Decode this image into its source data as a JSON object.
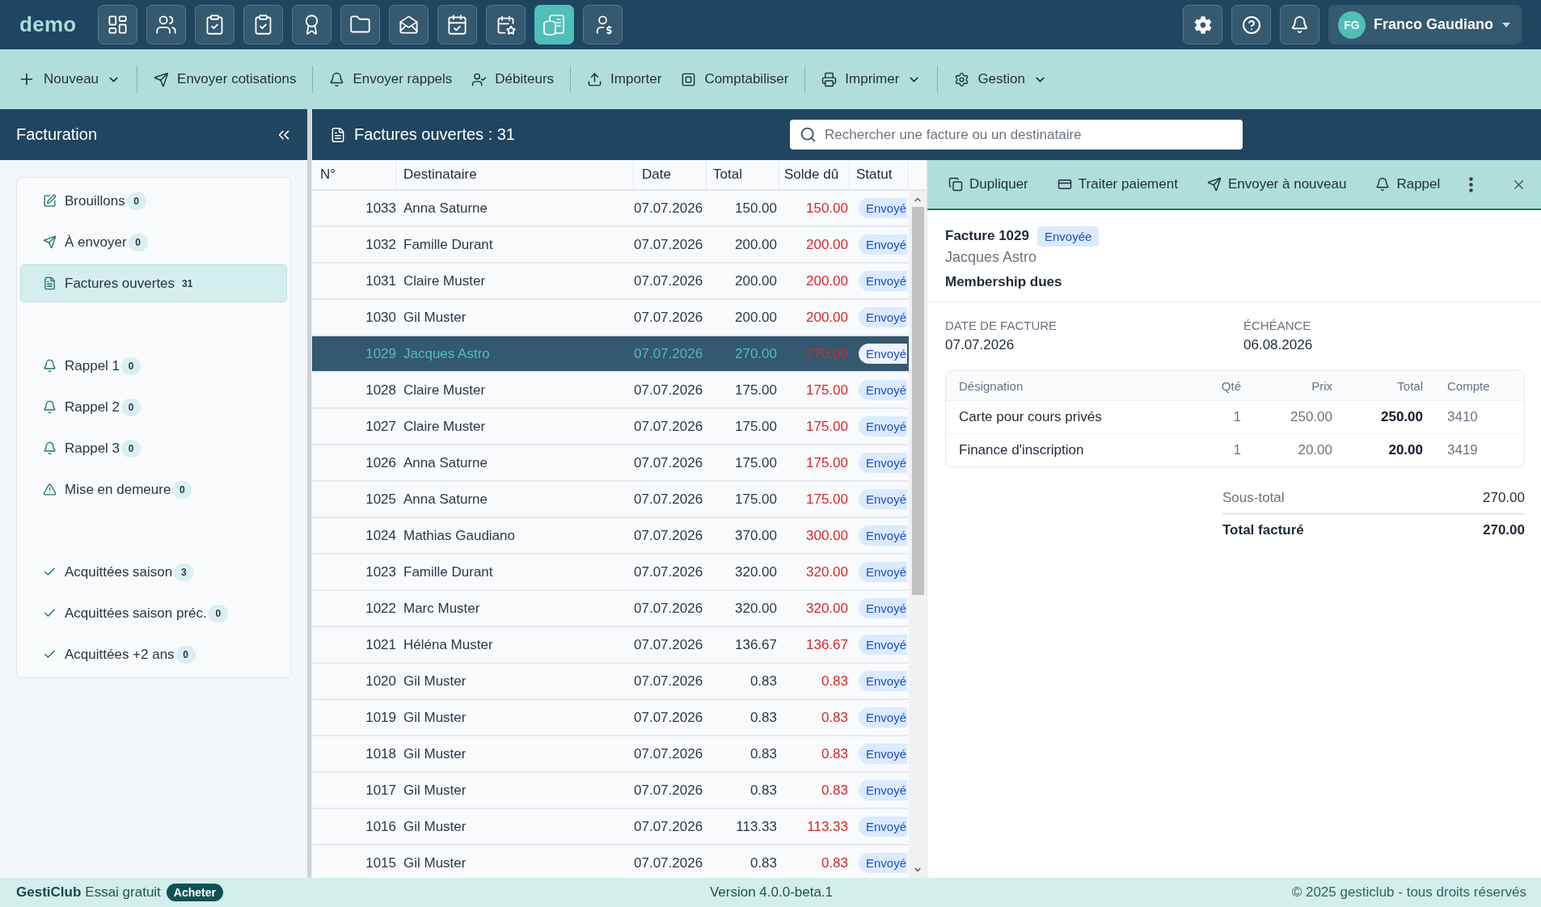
{
  "top_bar": {
    "logo": "demo",
    "apps": [
      {
        "selected": false
      },
      {
        "selected": false
      },
      {
        "selected": false
      },
      {
        "selected": false
      },
      {
        "selected": false
      },
      {
        "selected": false
      },
      {
        "selected": false
      },
      {
        "selected": false
      },
      {
        "selected": false
      },
      {
        "selected": true
      },
      {
        "selected": false
      }
    ],
    "user": {
      "initials": "FG",
      "name": "Franco Gaudiano"
    }
  },
  "toolbar": {
    "groups": [
      [
        {
          "label": "Nouveau",
          "dropdown": true
        }
      ],
      [
        {
          "label": "Envoyer cotisations",
          "dropdown": false
        }
      ],
      [
        {
          "label": "Envoyer rappels",
          "dropdown": false
        },
        {
          "label": "Débiteurs",
          "dropdown": false
        }
      ],
      [
        {
          "label": "Importer",
          "dropdown": false
        },
        {
          "label": "Comptabiliser",
          "dropdown": false
        }
      ],
      [
        {
          "label": "Imprimer",
          "dropdown": true
        }
      ],
      [
        {
          "label": "Gestion",
          "dropdown": true
        }
      ]
    ]
  },
  "sidebar": {
    "title": "Facturation",
    "groups": [
      {
        "items": [
          {
            "label": "Brouillons",
            "count": "0",
            "selected": false
          },
          {
            "label": "À envoyer",
            "count": "0",
            "selected": false
          },
          {
            "label": "Factures ouvertes",
            "count": "31",
            "selected": true
          }
        ]
      },
      {
        "items": [
          {
            "label": "Rappel 1",
            "count": "0",
            "selected": false
          },
          {
            "label": "Rappel 2",
            "count": "0",
            "selected": false
          },
          {
            "label": "Rappel 3",
            "count": "0",
            "selected": false
          },
          {
            "label": "Mise en demeure",
            "count": "0",
            "selected": false
          }
        ]
      },
      {
        "items": [
          {
            "label": "Acquittées saison",
            "count": "3",
            "selected": false
          },
          {
            "label": "Acquittées saison préc.",
            "count": "0",
            "selected": false
          },
          {
            "label": "Acquittées +2 ans",
            "count": "0",
            "selected": false
          }
        ]
      }
    ]
  },
  "list_header": {
    "title": "Factures ouvertes : 31",
    "search": {
      "placeholder": "Rechercher une facture ou un destinataire"
    }
  },
  "table": {
    "columns": [
      "N°",
      "Destinataire",
      "Date",
      "Total",
      "Solde dû",
      "Statut"
    ],
    "rows": [
      {
        "number": "1033",
        "recipient": "Anna Saturne",
        "date": "07.07.2026",
        "total": "150.00",
        "balance": "150.00",
        "status": "Envoyé",
        "selected": false
      },
      {
        "number": "1032",
        "recipient": "Famille Durant",
        "date": "07.07.2026",
        "total": "200.00",
        "balance": "200.00",
        "status": "Envoyé",
        "selected": false
      },
      {
        "number": "1031",
        "recipient": "Claire Muster",
        "date": "07.07.2026",
        "total": "200.00",
        "balance": "200.00",
        "status": "Envoyé",
        "selected": false
      },
      {
        "number": "1030",
        "recipient": "Gil Muster",
        "date": "07.07.2026",
        "total": "200.00",
        "balance": "200.00",
        "status": "Envoyé",
        "selected": false
      },
      {
        "number": "1029",
        "recipient": "Jacques Astro",
        "date": "07.07.2026",
        "total": "270.00",
        "balance": "270.00",
        "status": "Envoyé",
        "selected": true
      },
      {
        "number": "1028",
        "recipient": "Claire Muster",
        "date": "07.07.2026",
        "total": "175.00",
        "balance": "175.00",
        "status": "Envoyé",
        "selected": false
      },
      {
        "number": "1027",
        "recipient": "Claire Muster",
        "date": "07.07.2026",
        "total": "175.00",
        "balance": "175.00",
        "status": "Envoyé",
        "selected": false
      },
      {
        "number": "1026",
        "recipient": "Anna Saturne",
        "date": "07.07.2026",
        "total": "175.00",
        "balance": "175.00",
        "status": "Envoyé",
        "selected": false
      },
      {
        "number": "1025",
        "recipient": "Anna Saturne",
        "date": "07.07.2026",
        "total": "175.00",
        "balance": "175.00",
        "status": "Envoyé",
        "selected": false
      },
      {
        "number": "1024",
        "recipient": "Mathias Gaudiano",
        "date": "07.07.2026",
        "total": "370.00",
        "balance": "300.00",
        "status": "Envoyé",
        "selected": false
      },
      {
        "number": "1023",
        "recipient": "Famille Durant",
        "date": "07.07.2026",
        "total": "320.00",
        "balance": "320.00",
        "status": "Envoyé",
        "selected": false
      },
      {
        "number": "1022",
        "recipient": "Marc Muster",
        "date": "07.07.2026",
        "total": "320.00",
        "balance": "320.00",
        "status": "Envoyé",
        "selected": false
      },
      {
        "number": "1021",
        "recipient": "Héléna Muster",
        "date": "07.07.2026",
        "total": "136.67",
        "balance": "136.67",
        "status": "Envoyé",
        "selected": false
      },
      {
        "number": "1020",
        "recipient": "Gil Muster",
        "date": "07.07.2026",
        "total": "0.83",
        "balance": "0.83",
        "status": "Envoyé",
        "selected": false
      },
      {
        "number": "1019",
        "recipient": "Gil Muster",
        "date": "07.07.2026",
        "total": "0.83",
        "balance": "0.83",
        "status": "Envoyé",
        "selected": false
      },
      {
        "number": "1018",
        "recipient": "Gil Muster",
        "date": "07.07.2026",
        "total": "0.83",
        "balance": "0.83",
        "status": "Envoyé",
        "selected": false
      },
      {
        "number": "1017",
        "recipient": "Gil Muster",
        "date": "07.07.2026",
        "total": "0.83",
        "balance": "0.83",
        "status": "Envoyé",
        "selected": false
      },
      {
        "number": "1016",
        "recipient": "Gil Muster",
        "date": "07.07.2026",
        "total": "113.33",
        "balance": "113.33",
        "status": "Envoyé",
        "selected": false
      },
      {
        "number": "1015",
        "recipient": "Gil Muster",
        "date": "07.07.2026",
        "total": "0.83",
        "balance": "0.83",
        "status": "Envoyé",
        "selected": false
      }
    ]
  },
  "detail": {
    "actions": [
      {
        "label": "Dupliquer"
      },
      {
        "label": "Traiter paiement"
      },
      {
        "label": "Envoyer à nouveau"
      },
      {
        "label": "Rappel"
      }
    ],
    "title": "Facture 1029",
    "status": "Envoyée",
    "recipient": "Jacques Astro",
    "subject": "Membership dues",
    "fields": [
      {
        "label": "DATE DE FACTURE",
        "value": "07.07.2026"
      },
      {
        "label": "ÉCHÉANCE",
        "value": "06.08.2026"
      }
    ],
    "lines": {
      "columns": [
        "Désignation",
        "Qté",
        "Prix",
        "Total",
        "Compte"
      ],
      "rows": [
        {
          "designation": "Carte pour cours privés",
          "quantity": "1",
          "price": "250.00",
          "total": "250.00",
          "account": "3410"
        },
        {
          "designation": "Finance d'inscription",
          "quantity": "1",
          "price": "20.00",
          "total": "20.00",
          "account": "3419"
        }
      ]
    },
    "totals": [
      {
        "kind": "subtotal",
        "label": "Sous-total",
        "value": "270.00"
      },
      {
        "kind": "grand",
        "label": "Total facturé",
        "value": "270.00"
      }
    ]
  },
  "footer": {
    "brand": "GestiClub",
    "plan": "Essai gratuit",
    "buy_button": "Acheter",
    "version": "Version 4.0.0-beta.1",
    "copyright": "© 2025 gesticlub - tous droits réservés"
  }
}
